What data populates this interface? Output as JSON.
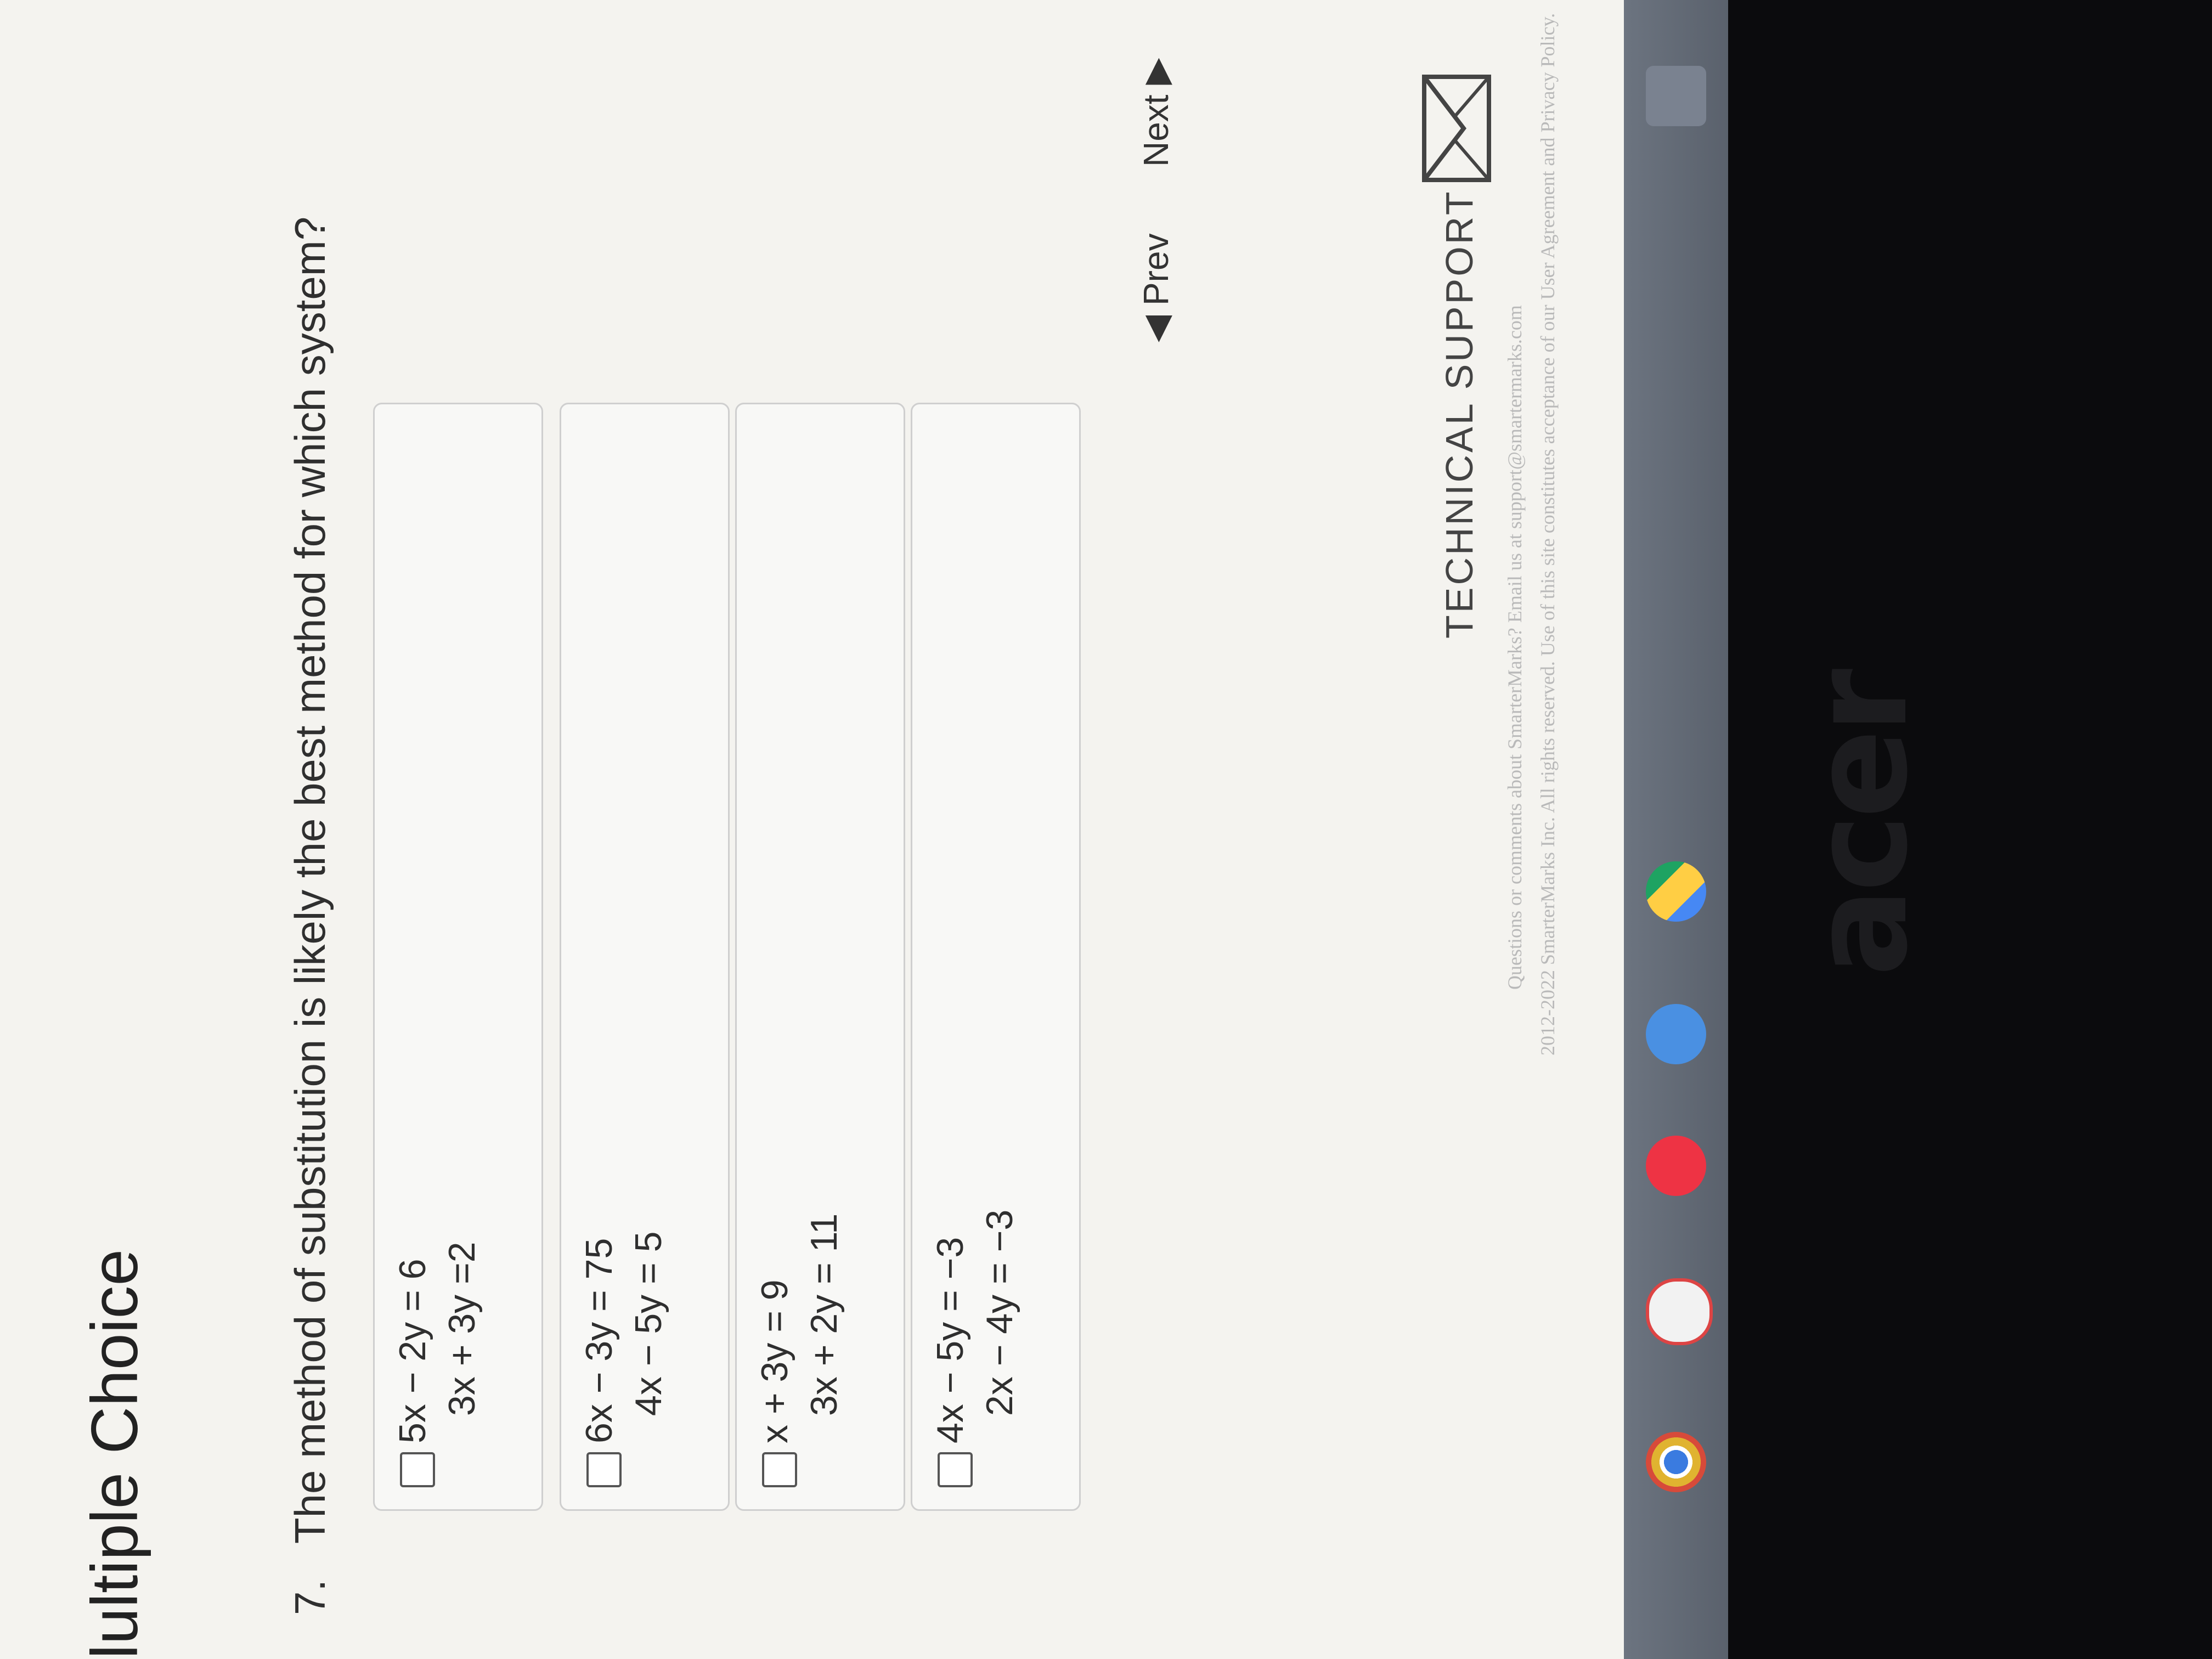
{
  "page": {
    "heading": "lultiple Choice"
  },
  "question": {
    "number": "7.",
    "text": "The method of substitution is likely the best method for which system?"
  },
  "choices": [
    {
      "eq1": "5x − 2y = 6",
      "eq2": "3x + 3y =2"
    },
    {
      "eq1": "6x − 3y = 75",
      "eq2": "4x − 5y = 5"
    },
    {
      "eq1": "x + 3y = 9",
      "eq2": "3x + 2y = 11"
    },
    {
      "eq1": "4x − 5y = −3",
      "eq2": "2x − 4y = −3"
    }
  ],
  "nav": {
    "prev_label": "◀ Prev",
    "next_label": "Next ▶"
  },
  "support": {
    "title": "TECHNICAL SUPPORT",
    "line1": "Questions or comments about SmarterMarks? Email us at support@smartermarks.com",
    "line2": "2012-2022 SmarterMarks Inc. All rights reserved. Use of this site constitutes acceptance of our User Agreement and Privacy Policy."
  },
  "device": {
    "brand": "acer"
  },
  "colors": {
    "screen_bg": "#f4f3ef",
    "bezel": "#0b0b0d",
    "taskbar": "#5a616c"
  },
  "icons": [
    "chrome-icon",
    "gmail-icon",
    "youtube-icon",
    "docs-icon",
    "drive-icon",
    "files-icon"
  ]
}
